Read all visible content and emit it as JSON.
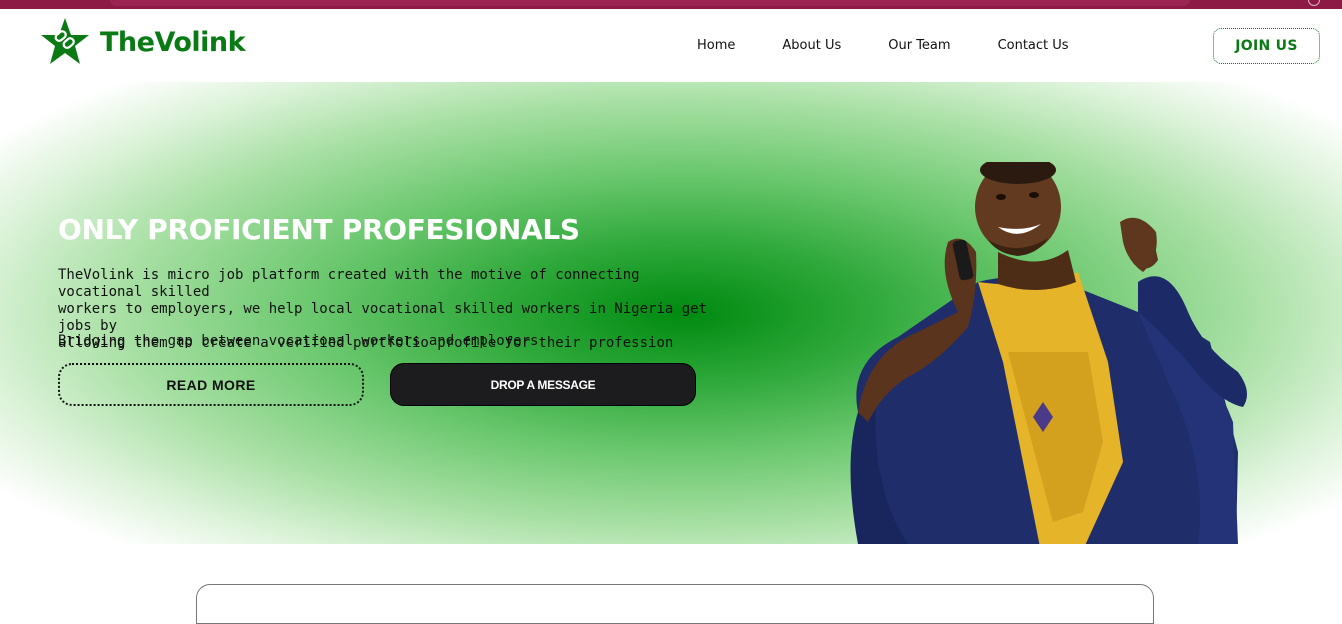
{
  "brand": {
    "name": "TheVolink",
    "logo_icon": "star-link-icon",
    "color": "#0a7a14"
  },
  "nav": {
    "items": [
      {
        "label": "Home"
      },
      {
        "label": "About Us"
      },
      {
        "label": "Our Team"
      },
      {
        "label": "Contact Us"
      }
    ],
    "join_label": "JOIN US"
  },
  "hero": {
    "title": "ONLY PROFICIENT PROFESIONALS",
    "description_lines": [
      "TheVolink is micro job platform created with the motive of connecting vocational skilled",
      "workers to employers, we help local vocational skilled workers in Nigeria get jobs by",
      "allowing them to create a verified portfolio profile for their profession"
    ],
    "tagline": "Bridging the gap between vocational workers and employers",
    "read_more_label": "READ MORE",
    "drop_message_label": "DROP A MESSAGE",
    "image": "man-in-agbada-on-phone"
  },
  "colors": {
    "topbar": "#8c1a45",
    "accent": "#0a7a14",
    "hero_center": "#008a10",
    "dark_button": "#1c1c1e"
  }
}
